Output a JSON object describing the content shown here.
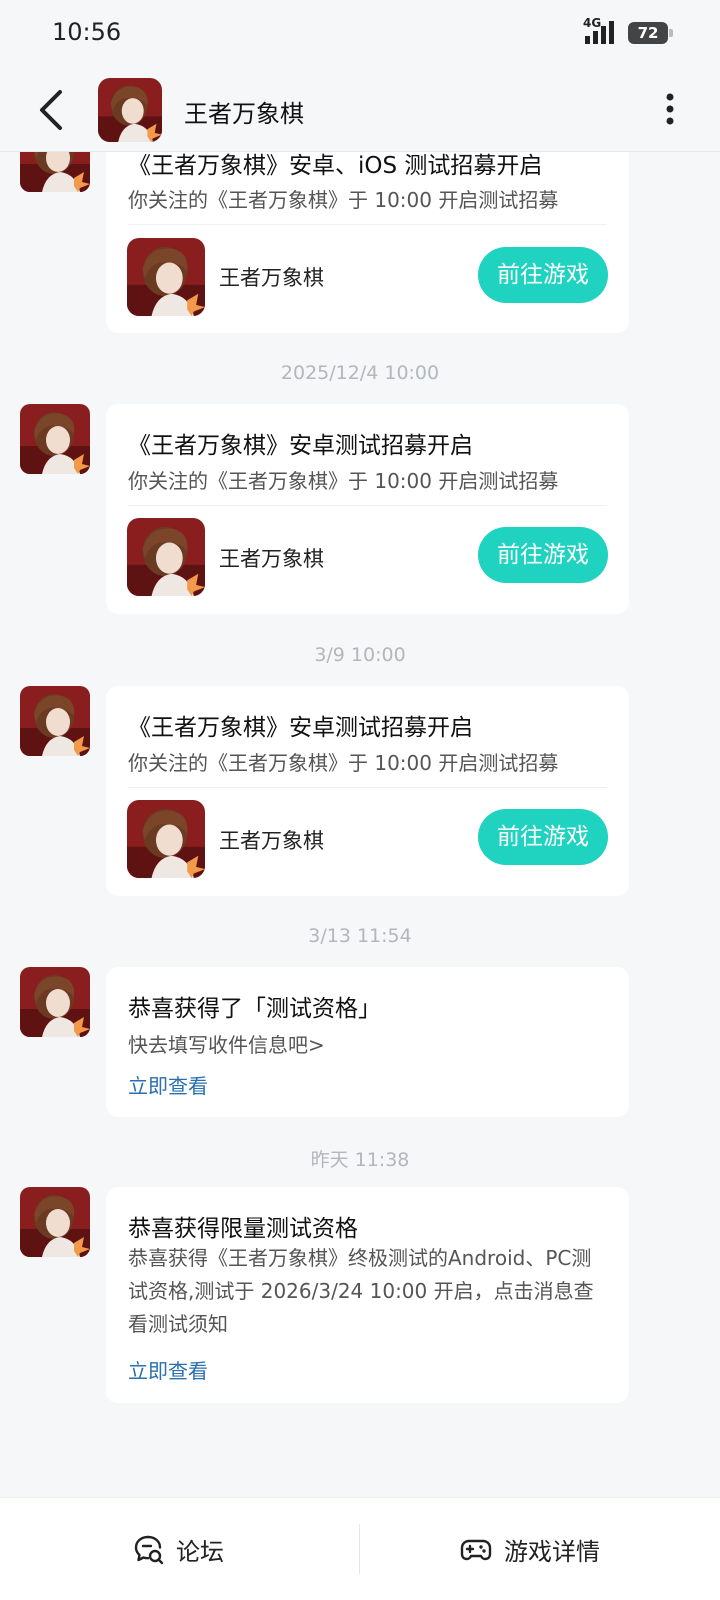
{
  "status_bar": {
    "time": "10:56",
    "network": "4G",
    "battery": "72"
  },
  "header": {
    "title": "王者万象棋"
  },
  "messages": [
    {
      "title": "《王者万象棋》安卓、iOS 测试招募开启",
      "desc": "你关注的《王者万象棋》于 10:00 开启测试招募",
      "game_name": "王者万象棋",
      "button": "前往游戏"
    },
    {
      "timestamp": "2025/12/4  10:00",
      "title": "《王者万象棋》安卓测试招募开启",
      "desc": "你关注的《王者万象棋》于 10:00 开启测试招募",
      "game_name": "王者万象棋",
      "button": "前往游戏"
    },
    {
      "timestamp": "3/9  10:00",
      "title": "《王者万象棋》安卓测试招募开启",
      "desc": "你关注的《王者万象棋》于 10:00 开启测试招募",
      "game_name": "王者万象棋",
      "button": "前往游戏"
    },
    {
      "timestamp": "3/13  11:54",
      "title": "恭喜获得了「测试资格」",
      "desc": "快去填写收件信息吧>",
      "link": "立即查看"
    },
    {
      "timestamp": "昨天  11:38",
      "title": "恭喜获得限量测试资格",
      "body": "恭喜获得《王者万象棋》终极测试的Android、PC测试资格,测试于 2026/3/24 10:00 开启，点击消息查看测试须知",
      "link": "立即查看"
    }
  ],
  "bottom_bar": {
    "forum": {
      "label": "论坛",
      "icon": "forum-chat-icon"
    },
    "details": {
      "label": "游戏详情",
      "icon": "gamepad-icon"
    }
  },
  "colors": {
    "accent": "#1fd3c0",
    "link": "#2a6fb0",
    "background": "#f6f7f9"
  }
}
